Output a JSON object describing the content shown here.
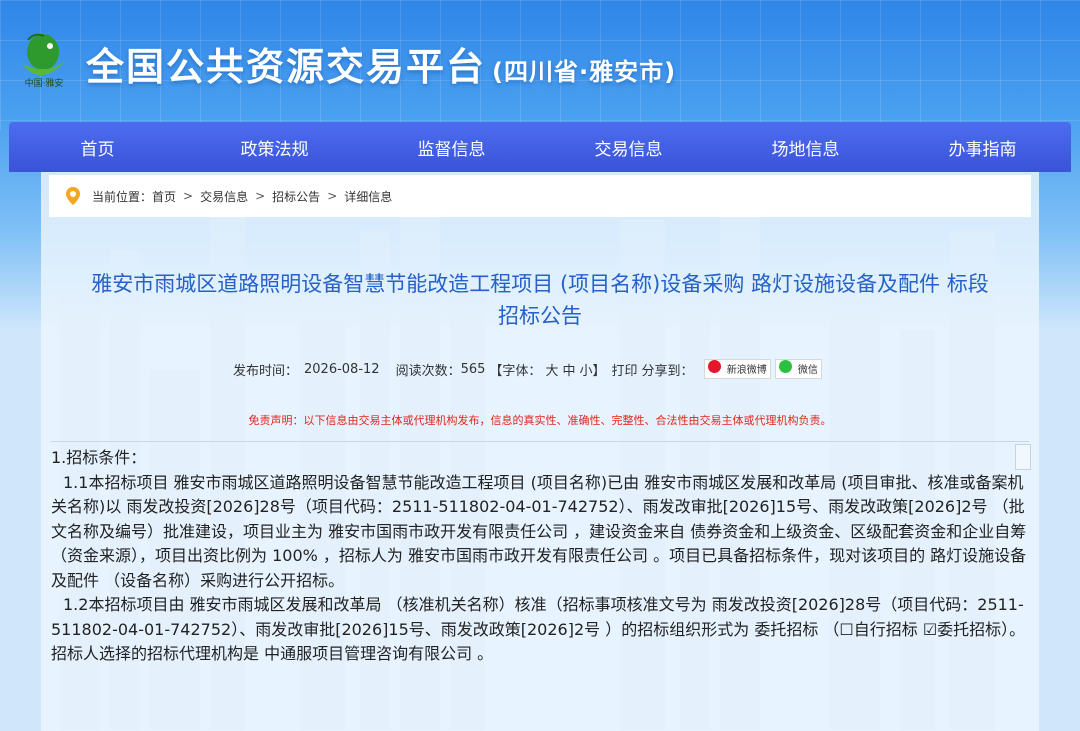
{
  "header": {
    "logo_text": "中国·雅安",
    "title": "全国公共资源交易平台",
    "subtitle": "(四川省·雅安市)"
  },
  "nav": {
    "items": [
      "首页",
      "政策法规",
      "监督信息",
      "交易信息",
      "场地信息",
      "办事指南"
    ]
  },
  "breadcrumb": {
    "label": "当前位置：",
    "items": [
      "首页",
      "交易信息",
      "招标公告",
      "详细信息"
    ],
    "separator": ">"
  },
  "article": {
    "title_line1": "雅安市雨城区道路照明设备智慧节能改造工程项目 (项目名称)设备采购 路灯设施设备及配件 标段",
    "title_line2": "招标公告",
    "meta": {
      "publish_label": "发布时间：",
      "publish_date": "2026-08-12",
      "reads_label": "阅读次数：",
      "reads": "565",
      "font_label": "【字体：",
      "font_sizes": [
        "大",
        "中",
        "小"
      ],
      "font_close": "】",
      "print": "打印",
      "share_label": "分享到：",
      "share_weibo": "新浪微博",
      "share_wechat": "微信"
    },
    "disclaimer": "免责声明：以下信息由交易主体或代理机构发布，信息的真实性、准确性、完整性、合法性由交易主体或代理机构负责。",
    "section1_heading": "1.招标条件：",
    "para_1_1": "1.1本招标项目 雅安市雨城区道路照明设备智慧节能改造工程项目 (项目名称)已由 雅安市雨城区发展和改革局 (项目审批、核准或备案机关名称)以 雨发改投资[2026]28号（项目代码：2511-511802-04-01-742752）、雨发改审批[2026]15号、雨发改政策[2026]2号 （批文名称及编号）批准建设，项目业主为 雅安市国雨市政开发有限责任公司 ，建设资金来自 债券资金和上级资金、区级配套资金和企业自筹 （资金来源），项目出资比例为 100% ，招标人为 雅安市国雨市政开发有限责任公司 。项目已具备招标条件，现对该项目的 路灯设施设备及配件 （设备名称）采购进行公开招标。",
    "para_1_2": "1.2本招标项目由 雅安市雨城区发展和改革局 （核准机关名称）核准（招标事项核准文号为 雨发改投资[2026]28号（项目代码：2511-511802-04-01-742752）、雨发改审批[2026]15号、雨发改政策[2026]2号 ）的招标组织形式为 委托招标 （☐自行招标 ☑委托招标）。招标人选择的招标代理机构是 中通服项目管理咨询有限公司 。"
  },
  "colors": {
    "nav_bg": "#3f5be0",
    "title_color": "#2561c8",
    "disclaimer_color": "#e0261c"
  }
}
